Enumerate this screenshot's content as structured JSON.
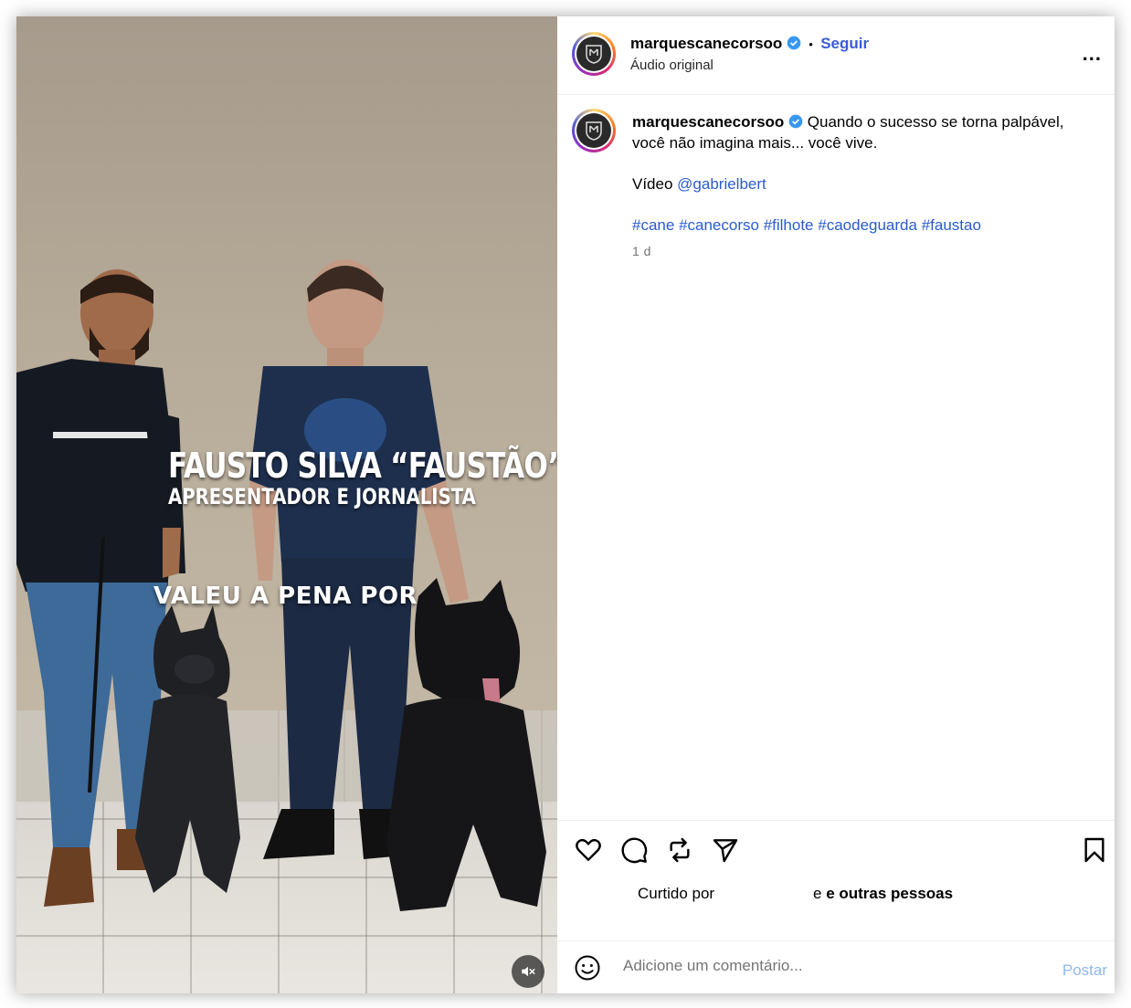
{
  "post": {
    "username": "marquescanecorsoo",
    "follow_label": "Seguir",
    "separator": "•",
    "audio_label": "Áudio original",
    "more_label": "..."
  },
  "caption": {
    "username": "marquescanecorsoo",
    "line1": "Quando o sucesso se torna palpável, você não imagina mais... você vive.",
    "video_prefix": "Vídeo",
    "video_mention": "@gabrielbert",
    "hashtags": [
      "#cane",
      "#canecorso",
      "#filhote",
      "#caodeguarda",
      "#faustao"
    ],
    "time": "1 d"
  },
  "video_overlay": {
    "name": "FAUSTO SILVA “FAUSTÃO”",
    "role": "APRESENTADOR E JORNALISTA",
    "caption": "VALEU A PENA POR"
  },
  "likes": {
    "prefix": "Curtido por",
    "suffix": "e outras pessoas"
  },
  "comment": {
    "placeholder": "Adicione um comentário...",
    "post_label": "Postar"
  },
  "icons": {
    "like": "heart-icon",
    "comment": "comment-bubble-icon",
    "repost": "repost-icon",
    "share": "send-icon",
    "save": "bookmark-icon",
    "emoji": "emoji-icon",
    "mute": "muted-speaker-icon",
    "verified": "verified-badge-icon"
  },
  "colors": {
    "accent": "#3a5bd9",
    "verified": "#3897f0",
    "link": "#2b5bd0",
    "muted_text": "#737373",
    "post_disabled": "#8fb8ec"
  }
}
